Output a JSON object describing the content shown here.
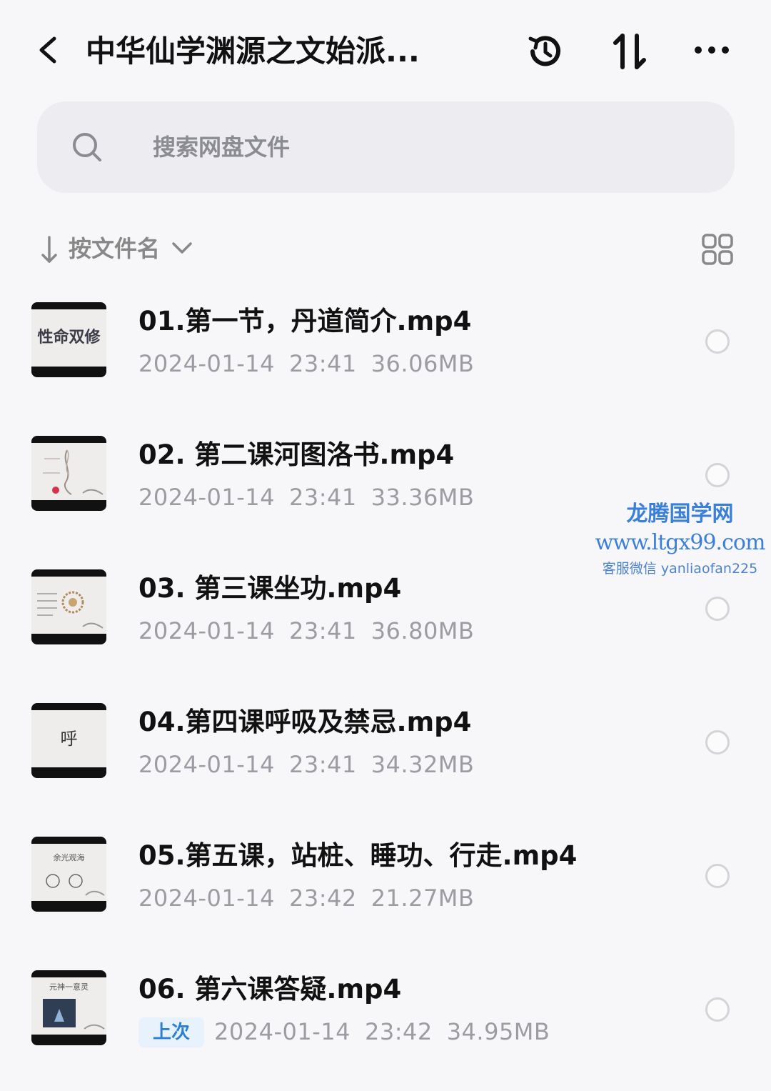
{
  "header": {
    "title": "中华仙学渊源之文始派...",
    "icons": [
      "back-icon",
      "history-icon",
      "sort-swap-icon",
      "more-icon"
    ]
  },
  "search": {
    "placeholder": "搜索网盘文件"
  },
  "sort": {
    "label": "按文件名"
  },
  "files": [
    {
      "name": "01.第一节，丹道简介.mp4",
      "date": "2024-01-14",
      "time": "23:41",
      "size": "36.06MB",
      "thumb_text": "性命双修"
    },
    {
      "name": "02. 第二课河图洛书.mp4",
      "date": "2024-01-14",
      "time": "23:41",
      "size": "33.36MB",
      "thumb_text": ""
    },
    {
      "name": "03. 第三课坐功.mp4",
      "date": "2024-01-14",
      "time": "23:41",
      "size": "36.80MB",
      "thumb_text": ""
    },
    {
      "name": "04.第四课呼吸及禁忌.mp4",
      "date": "2024-01-14",
      "time": "23:41",
      "size": "34.32MB",
      "thumb_text": "呼"
    },
    {
      "name": "05.第五课，站桩、睡功、行走.mp4",
      "date": "2024-01-14",
      "time": "23:42",
      "size": "21.27MB",
      "thumb_text": "余光观海"
    },
    {
      "name": "06. 第六课答疑.mp4",
      "date": "2024-01-14",
      "time": "23:42",
      "size": "34.95MB",
      "thumb_text": "元神一意灵",
      "badge": "上次"
    }
  ],
  "watermark": {
    "line1": "龙腾国学网",
    "line2": "www.ltgx99.com",
    "line3": "客服微信 yanliaofan225"
  },
  "colors": {
    "accent": "#2d7fd6",
    "background": "#f7f7f9"
  }
}
